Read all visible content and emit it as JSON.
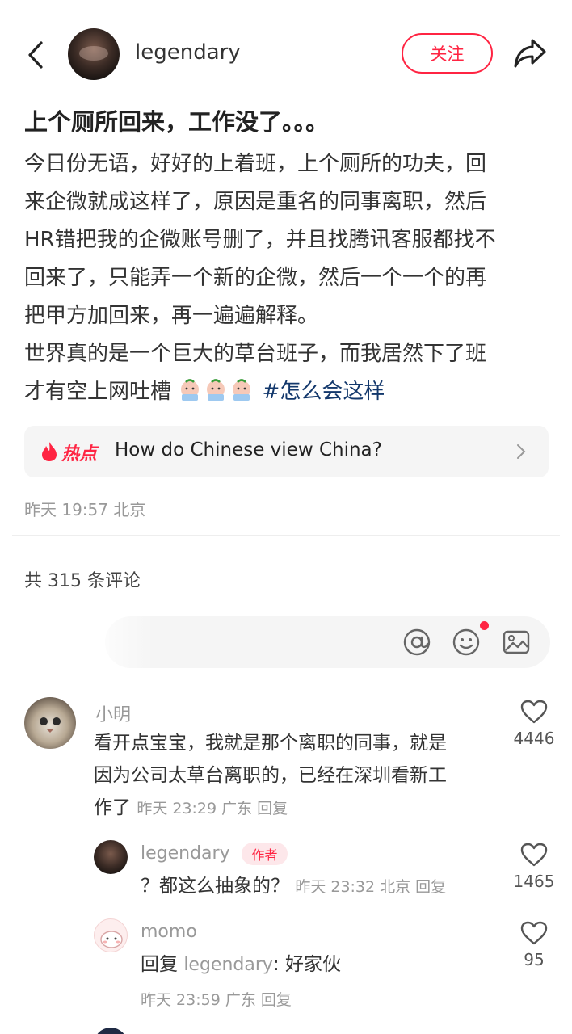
{
  "header": {
    "username": "legendary",
    "follow_label": "关注",
    "icons": {
      "back": "chevron-left-icon",
      "share": "share-arrow-icon"
    }
  },
  "post": {
    "title": "上个厕所回来，工作没了。。。",
    "content_lines": [
      "今日份无语，好好的上着班，上个厕所的功夫，回",
      "来企微就成这样了，原因是重名的同事离职，然后",
      "HR错把我的企微账号删了，并且找腾讯客服都找不",
      "回来了，只能弄一个新的企微，然后一个一个的再",
      "把甲方加回来，再一遍遍解释。",
      "世界真的是一个巨大的草台班子，而我居然下了班",
      "才有空上网吐槽"
    ],
    "hashtag": "#怎么会这样",
    "topic_tag": "热点",
    "topic_text": "How do Chinese view China?",
    "meta": "昨天 19:57 北京"
  },
  "comments_header": {
    "count_label": "共 315 条评论"
  },
  "comment_input": {
    "icons": [
      "at-icon",
      "emoji-icon",
      "image-icon"
    ]
  },
  "comments": [
    {
      "name": "小明",
      "text_lines": [
        "看开点宝宝，我就是那个离职的同事，就是",
        "因为公司太草台离职的，已经在深圳看新工",
        "作了"
      ],
      "meta": "昨天 23:29 广东 回复",
      "likes": "4446"
    },
    {
      "name": "legendary",
      "badge": "作者",
      "text": "？都这么抽象的？",
      "meta": "昨天 23:32 北京 回复",
      "likes": "1465"
    },
    {
      "name": "momo",
      "reply_prefix": "回复",
      "reply_to": "legendary",
      "text": ": 好家伙",
      "meta": "昨天 23:59 广东 回复",
      "likes": "95"
    }
  ],
  "colors": {
    "accent": "#ff2442",
    "hashtag": "#13386c",
    "muted": "#999999"
  }
}
